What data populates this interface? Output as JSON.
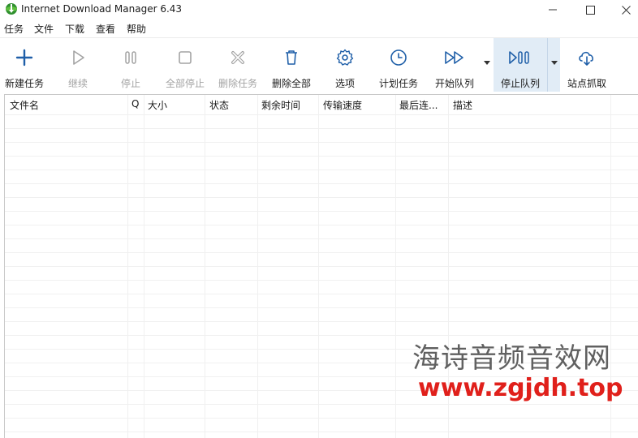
{
  "window": {
    "title": "Internet Download Manager 6.43"
  },
  "menu": [
    "任务",
    "文件",
    "下载",
    "查看",
    "帮助"
  ],
  "toolbar": {
    "new_task": "新建任务",
    "resume": "继续",
    "stop": "停止",
    "stop_all": "全部停止",
    "delete_task": "删除任务",
    "delete_all": "删除全部",
    "options": "选项",
    "scheduler": "计划任务",
    "start_queue": "开始队列",
    "stop_queue": "停止队列",
    "site_grabber": "站点抓取"
  },
  "columns": [
    "文件名",
    "Q",
    "大小",
    "状态",
    "剩余时间",
    "传输速度",
    "最后连...",
    "描述"
  ],
  "watermark": {
    "name": "海诗音频音效网",
    "url": "www.zgjdh.top"
  },
  "colors": {
    "accent": "#1f5fa8",
    "disabled": "#a3a3a3",
    "active_bg": "#e1ecf6",
    "watermark_url": "#e0201b"
  }
}
